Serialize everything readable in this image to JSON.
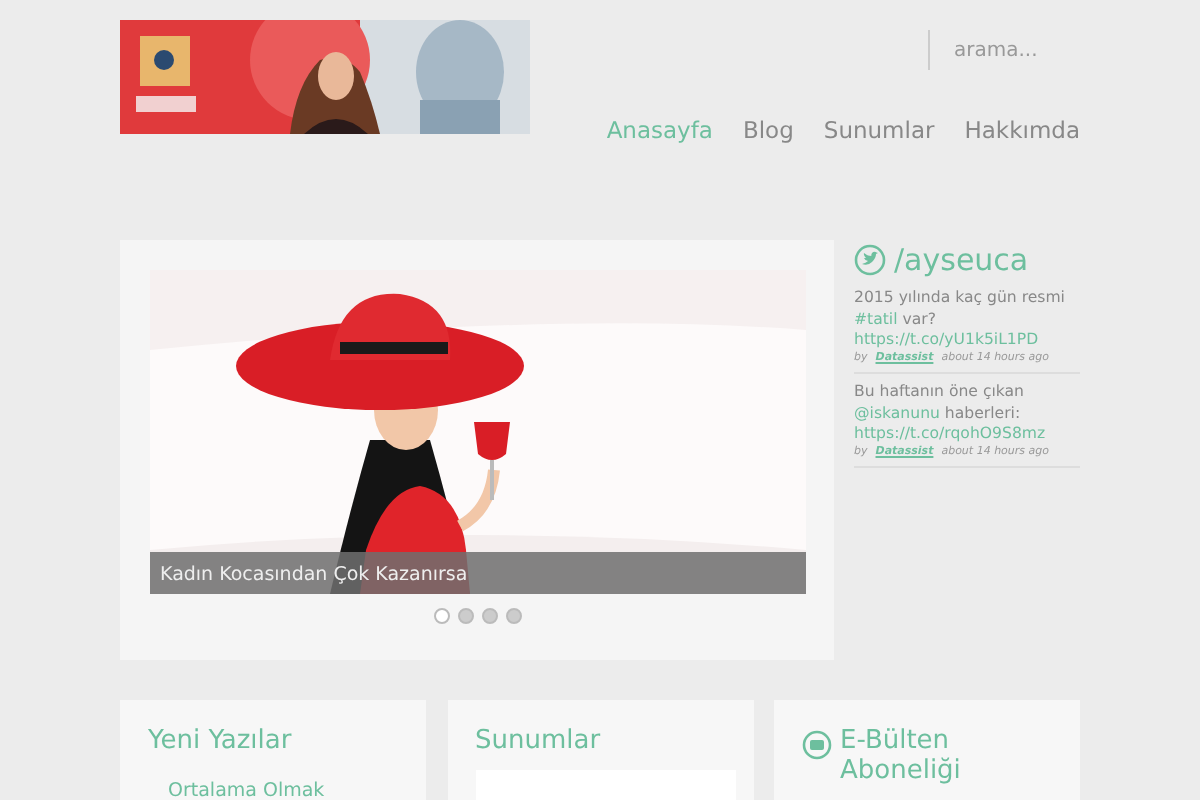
{
  "search": {
    "placeholder": "arama..."
  },
  "nav": [
    {
      "label": "Anasayfa",
      "selected": true
    },
    {
      "label": "Blog",
      "selected": false
    },
    {
      "label": "Sunumlar",
      "selected": false
    },
    {
      "label": "Hakkımda",
      "selected": false
    }
  ],
  "slider": {
    "caption": "Kadın Kocasından Çok Kazanırsa",
    "dots": [
      {
        "selected": true
      },
      {
        "selected": false
      },
      {
        "selected": false
      },
      {
        "selected": false
      }
    ]
  },
  "twitter": {
    "handle": "/ayseuca",
    "tweets": [
      {
        "text": "2015 yılında kaç gün resmi **#tatil** var?",
        "link": "https://t.co/yU1k5iL1PD",
        "by": "by",
        "author": "Datassist",
        "time": "about 14 hours ago"
      },
      {
        "text": "Bu haftanın öne çıkan **@iskanunu** haberleri:",
        "link": "https://t.co/rqohO9S8mz",
        "by": "by",
        "author": "Datassist",
        "time": "about 14 hours ago"
      }
    ]
  },
  "widgets": [
    {
      "kind": "list",
      "title": "Yeni Yazılar",
      "items": [
        "Ortalama Olmak"
      ]
    },
    {
      "kind": "slides",
      "title": "Sunumlar"
    },
    {
      "kind": "newsletter",
      "title": "E-Bülten Aboneliği"
    }
  ]
}
